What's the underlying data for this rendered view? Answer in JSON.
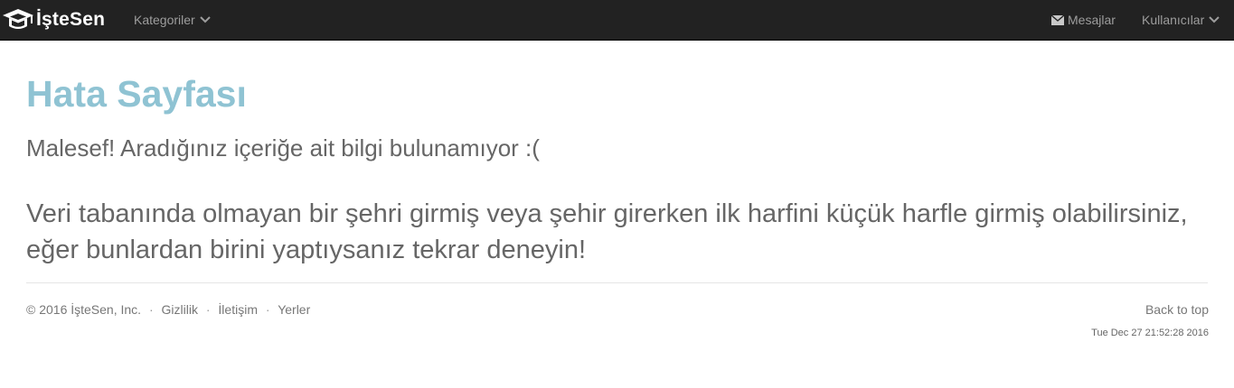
{
  "navbar": {
    "brand": "İşteSen",
    "kategoriler_label": "Kategoriler",
    "mesajlar_label": "Mesajlar",
    "kullanicilar_label": "Kullanıcılar"
  },
  "main": {
    "title": "Hata Sayfası",
    "message": "Malesef! Aradığınız içeriğe ait bilgi bulunamıyor :(",
    "hint": "Veri tabanında olmayan bir şehri girmiş veya şehir girerken ilk harfini küçük harfle girmiş olabilirsiniz, eğer bunlardan birini yaptıysanız tekrar deneyin!"
  },
  "footer": {
    "copyright": "© 2016 İşteSen, Inc.",
    "separator": "·",
    "links": [
      "Gizlilik",
      "İletişim",
      "Yerler"
    ],
    "back_to_top": "Back to top",
    "timestamp": "Tue Dec 27 21:52:28 2016"
  },
  "icons": {
    "logo": "graduation-cap-icon",
    "dropdown": "chevron-down-icon",
    "messages": "envelope-icon"
  },
  "colors": {
    "navbar_bg": "#222222",
    "title": "#8fc3d3",
    "text": "#666666"
  }
}
